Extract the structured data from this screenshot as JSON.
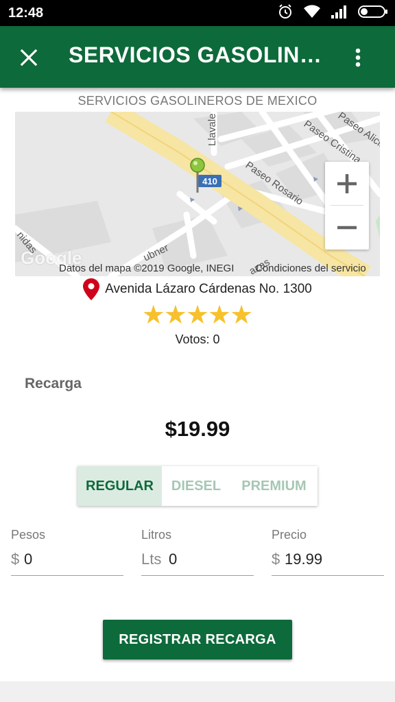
{
  "status_bar": {
    "time": "12:48",
    "icons": [
      "alarm-icon",
      "wifi-icon",
      "signal-icon",
      "battery-icon"
    ]
  },
  "app_bar": {
    "title": "SERVICIOS GASOLINEROS DE MEXICO",
    "close_icon": "close-icon",
    "more_icon": "more-vert-icon",
    "background": "#0d6a3a"
  },
  "station": {
    "name": "SERVICIOS GASOLINEROS DE MEXICO",
    "address": "Avenida Lázaro Cárdenas No. 1300",
    "rating": 5,
    "votes_label": "Votos: 0"
  },
  "map": {
    "street_labels": [
      "Llavale",
      "Paseo Cristina",
      "Paseo Alicia",
      "Paseo Rosario",
      "410",
      "nidas",
      "ubner",
      "azas"
    ],
    "attribution_data": "Datos del mapa ©2019 Google, INEGI",
    "attribution_terms": "Condiciones del servicio",
    "logo_text": "Google",
    "zoom_in": "+",
    "zoom_out": "−"
  },
  "recharge": {
    "section_title": "Recarga",
    "price": "$19.99",
    "fuel_types": [
      "REGULAR",
      "DIESEL",
      "PREMIUM"
    ],
    "selected_fuel": "REGULAR",
    "fields": {
      "pesos": {
        "label": "Pesos",
        "prefix": "$",
        "value": "0"
      },
      "litros": {
        "label": "Litros",
        "prefix": "Lts",
        "value": "0"
      },
      "precio": {
        "label": "Precio",
        "prefix": "$",
        "value": "19.99"
      }
    },
    "register_label": "REGISTRAR RECARGA"
  },
  "colors": {
    "primary": "#0d6a3a",
    "star": "#f6c12d",
    "pin": "#d0021b",
    "tab_inactive": "#a6c7b4",
    "tab_active_bg": "#dcebe2"
  }
}
